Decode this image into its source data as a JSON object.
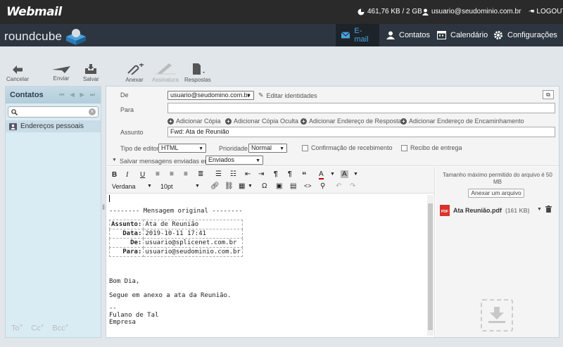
{
  "topbar": {
    "brand": "Webmail",
    "quota": "461,76 KB / 2 GB",
    "user": "usuario@seudominio.com.br",
    "logout": "LOGOUT"
  },
  "header": {
    "logo": "roundcube",
    "nav": [
      {
        "label": "E-mail",
        "icon": "envelope-icon",
        "active": true
      },
      {
        "label": "Contatos",
        "icon": "person-icon"
      },
      {
        "label": "Calendário",
        "icon": "calendar-icon"
      },
      {
        "label": "Configurações",
        "icon": "gear-icon"
      }
    ]
  },
  "toolbar": {
    "cancel": "Cancelar",
    "send": "Enviar",
    "save": "Salvar",
    "attach": "Anexar",
    "signature": "Assinatura",
    "responses": "Respostas"
  },
  "contacts": {
    "title": "Contatos",
    "item": "Endereços pessoais",
    "footer": [
      "To",
      "Cc",
      "Bcc"
    ]
  },
  "compose": {
    "from_label": "De",
    "from_value": "usuario@seudomino.com.br",
    "edit_identities": "Editar identidades",
    "to_label": "Para",
    "add_cc": "Adicionar Cópia",
    "add_bcc": "Adicionar Cópia Oculta",
    "add_reply": "Adicionar Endereço de Resposta",
    "add_forward": "Adicionar Endereço de Encaminhamento",
    "subject_label": "Assunto",
    "subject_value": "Fwd: Ata de Reunião",
    "editor_type_label": "Tipo de editor",
    "editor_type_value": "HTML",
    "priority_label": "Prioridade",
    "priority_value": "Normal",
    "receipt_label": "Confirmação de recebimento",
    "delivery_label": "Recibo de entrega",
    "save_sent_label": "Salvar mensagens enviadas em",
    "save_sent_value": "Enviados"
  },
  "editor": {
    "font": "Verdana",
    "size": "10pt",
    "original_header": "-------- Mensagem original --------",
    "rows": [
      {
        "key": "Assunto:",
        "value": "Ata de Reunião"
      },
      {
        "key": "Data:",
        "value": "2019-10-11 17:41"
      },
      {
        "key": "De:",
        "value": "usuario@splicenet.com.br"
      },
      {
        "key": "Para:",
        "value": "usuario@seudominio.com.br"
      }
    ],
    "greeting": "Bom Dia,",
    "body": "Segue em anexo a ata da Reunião.",
    "sig_sep": "--",
    "sig_name": "Fulano de Tal",
    "sig_company": "Empresa"
  },
  "attachments": {
    "limit": "Tamanho máximo permitido do arquivo é 50 MB",
    "button": "Anexar um arquivo",
    "file_name": "Ata Reunião.pdf",
    "file_size": "(161 KB)",
    "file_type": "PDF"
  }
}
